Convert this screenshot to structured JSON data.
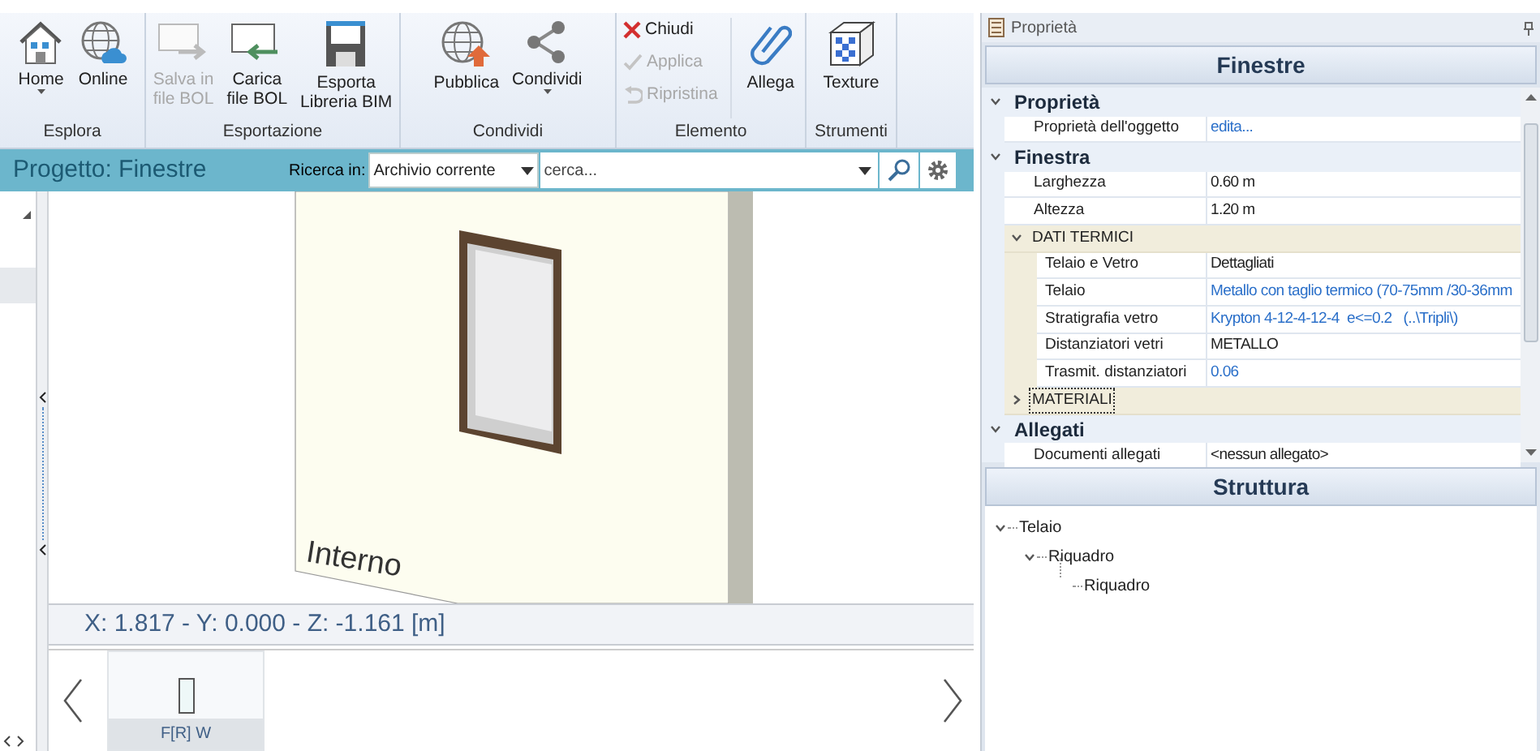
{
  "ribbon": {
    "groups": [
      {
        "label": "Esplora",
        "buttons": [
          {
            "kind": "large",
            "label": "Home",
            "disabled": false,
            "caret": true
          },
          {
            "kind": "large",
            "label": "Online",
            "disabled": false,
            "caret": false
          }
        ]
      },
      {
        "label": "Esportazione",
        "buttons": [
          {
            "kind": "large",
            "label": "Salva in\nfile BOL",
            "disabled": true,
            "caret": false
          },
          {
            "kind": "large",
            "label": "Carica\nfile BOL",
            "disabled": false,
            "caret": false
          },
          {
            "kind": "large",
            "label": "Esporta\nLibreria BIM",
            "disabled": false,
            "caret": false
          }
        ]
      },
      {
        "label": "Condividi",
        "buttons": [
          {
            "kind": "large",
            "label": "Pubblica",
            "disabled": false,
            "caret": false
          },
          {
            "kind": "large",
            "label": "Condividi",
            "disabled": false,
            "caret": true
          }
        ]
      },
      {
        "label": "Elemento",
        "buttons": [
          {
            "kind": "small",
            "label": "Chiudi",
            "disabled": false,
            "caret": false
          },
          {
            "kind": "small",
            "label": "Applica",
            "disabled": true,
            "caret": false
          },
          {
            "kind": "small",
            "label": "Ripristina",
            "disabled": true,
            "caret": false
          },
          {
            "kind": "large",
            "label": "Allega",
            "disabled": false,
            "caret": false
          }
        ]
      },
      {
        "label": "Strumenti",
        "buttons": [
          {
            "kind": "large",
            "label": "Texture",
            "disabled": false,
            "caret": false
          }
        ]
      }
    ]
  },
  "project_bar": {
    "title": "Progetto: Finestre",
    "search_in_label": "Ricerca in:",
    "scope": "Archivio corrente",
    "search": {
      "placeholder": "cerca..."
    }
  },
  "viewport": {
    "wall_label": "Interno",
    "coordinates": "X: 1.817 - Y: 0.000 - Z: -1.161 [m]"
  },
  "thumbnails": [
    {
      "label": "F[R] W",
      "selected": true
    }
  ],
  "properties_panel": {
    "header": "Proprietà",
    "title": "Finestre",
    "categories": [
      {
        "title": "Proprietà",
        "expanded": true,
        "items": [
          {
            "kind": "row",
            "label": "Proprietà dell'oggetto",
            "value": "edita...",
            "linked": true
          }
        ]
      },
      {
        "title": "Finestra",
        "expanded": true,
        "items": [
          {
            "kind": "row",
            "label": "Larghezza",
            "value": "0.60 m",
            "linked": false
          },
          {
            "kind": "row",
            "label": "Altezza",
            "value": "1.20 m",
            "linked": false
          },
          {
            "kind": "group",
            "label": "DATI TERMICI",
            "expanded": true,
            "selected": false,
            "items": [
              {
                "kind": "row",
                "label": "Telaio e Vetro",
                "value": "Dettagliati",
                "linked": false
              },
              {
                "kind": "row",
                "label": "Telaio",
                "value": "Metallo con taglio termico (70-75mm /30-36mm",
                "linked": true
              },
              {
                "kind": "row",
                "label": "Stratigrafia vetro",
                "value": "Krypton 4-12-4-12-4  e<=0.2   (..\\Tripli\\)",
                "linked": true
              },
              {
                "kind": "row",
                "label": "Distanziatori vetri",
                "value": "METALLO",
                "linked": false
              },
              {
                "kind": "row",
                "label": "Trasmit. distanziatori",
                "value": "0.06",
                "linked": true
              }
            ]
          },
          {
            "kind": "group",
            "label": "MATERIALI",
            "expanded": false,
            "selected": true
          }
        ]
      },
      {
        "title": "Allegati",
        "expanded": true,
        "items": [
          {
            "kind": "row",
            "label": "Documenti allegati",
            "value": "<nessun allegato>",
            "linked": false
          }
        ]
      }
    ]
  },
  "structure_panel": {
    "title": "Struttura",
    "tree": [
      {
        "label": "Telaio",
        "expanded": true,
        "children": [
          {
            "label": "Riquadro",
            "expanded": true,
            "children": [
              {
                "label": "Riquadro"
              }
            ]
          }
        ]
      }
    ]
  }
}
